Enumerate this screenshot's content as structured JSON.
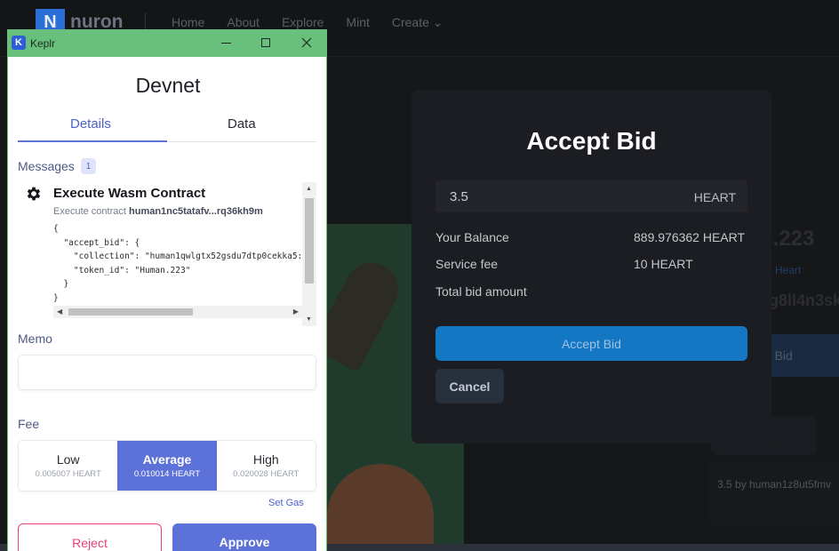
{
  "site": {
    "logo_letter": "N",
    "logo_text": "nuron",
    "nav": [
      "Home",
      "About",
      "Explore",
      "Mint",
      "Create"
    ],
    "create_chevron": "⌄",
    "bg_title": "n.223",
    "bg_link": "3 Heart",
    "bg_code": "5g8ll4n3sk",
    "bg_button": "ot Bid",
    "bg_button2": "s",
    "bg_bid": "3.5 by human1z8ut5fmv"
  },
  "modal": {
    "title": "Accept Bid",
    "bid_value": "3.5",
    "bid_unit": "HEART",
    "rows": [
      {
        "label": "Your Balance",
        "value": "889.976362 HEART"
      },
      {
        "label": "Service fee",
        "value": "10 HEART"
      },
      {
        "label": "Total bid amount",
        "value": ""
      }
    ],
    "accept_label": "Accept Bid",
    "cancel_label": "Cancel"
  },
  "keplr": {
    "window_title": "Keplr",
    "icon_letter": "K",
    "chain": "Devnet",
    "tabs": [
      "Details",
      "Data"
    ],
    "messages_label": "Messages",
    "messages_count": "1",
    "message": {
      "title": "Execute Wasm Contract",
      "sub_prefix": "Execute contract ",
      "contract": "human1nc5tatafv...rq36kh9m",
      "code": "{\n  \"accept_bid\": {\n    \"collection\": \"human1qwlgtx52gsdu7dtp0cekka5:\n    \"token_id\": \"Human.223\"\n  }\n}"
    },
    "memo_label": "Memo",
    "memo_value": "",
    "fee_label": "Fee",
    "fees": [
      {
        "name": "Low",
        "amount": "0.005007 HEART"
      },
      {
        "name": "Average",
        "amount": "0.010014 HEART"
      },
      {
        "name": "High",
        "amount": "0.020028 HEART"
      }
    ],
    "set_gas": "Set Gas",
    "reject_label": "Reject",
    "approve_label": "Approve",
    "colors": {
      "titlebar": "#68c07c",
      "accent": "#5c72d9",
      "reject": "#e7407a"
    }
  }
}
